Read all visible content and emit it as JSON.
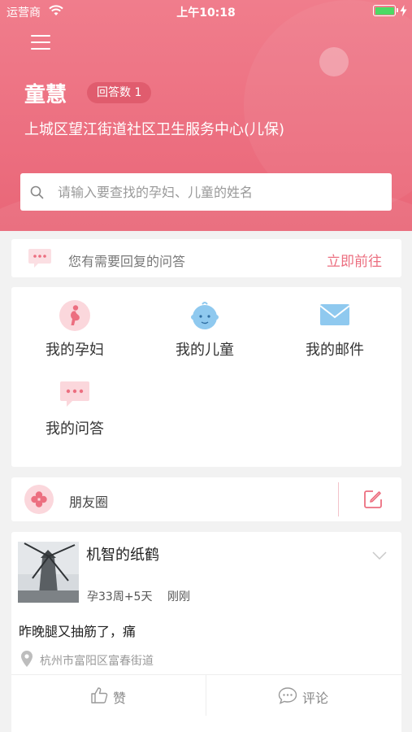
{
  "status_bar": {
    "carrier": "运营商",
    "time": "上午10:18"
  },
  "header": {
    "user_name": "童慧",
    "answer_badge": "回答数 1",
    "organization": "上城区望江街道社区卫生服务中心(儿保)",
    "search": {
      "placeholder": "请输入要查找的孕妇、儿童的姓名",
      "value": ""
    }
  },
  "notice": {
    "text": "您有需要回复的问答",
    "link_label": "立即前往"
  },
  "menu": {
    "items": [
      {
        "label": "我的孕妇",
        "icon": "pregnant-woman-icon"
      },
      {
        "label": "我的儿童",
        "icon": "child-face-icon"
      },
      {
        "label": "我的邮件",
        "icon": "mail-icon"
      },
      {
        "label": "我的问答",
        "icon": "chat-bubble-icon"
      }
    ]
  },
  "moments": {
    "label": "朋友圈",
    "icon": "clover-icon",
    "compose_icon": "compose-icon"
  },
  "post": {
    "author": "机智的纸鹤",
    "pregnancy": "孕33周+5天",
    "time": "刚刚",
    "content": "昨晚腿又抽筋了，痛",
    "location": "杭州市富阳区富春街道",
    "like_label": "赞",
    "comment_label": "评论"
  },
  "colors": {
    "accent": "#ec6f80",
    "header_top": "#f07d8c",
    "battery": "#4cd964"
  }
}
